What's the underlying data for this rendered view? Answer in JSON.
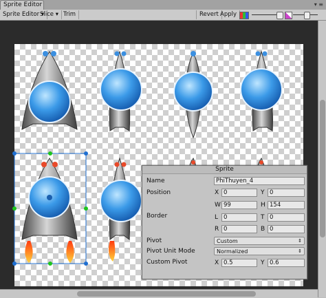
{
  "window": {
    "tab_title": "Sprite Editor",
    "controls": "▾ ≡"
  },
  "toolbar": {
    "sprite_editor_menu": "Sprite Editor ▾",
    "slice_menu": "Slice ▾",
    "trim_label": "Trim",
    "revert_label": "Revert",
    "apply_label": "Apply",
    "zoom_level": 0.55
  },
  "sprite_panel": {
    "title": "Sprite",
    "name_label": "Name",
    "name_value": "PhiThuyen_4",
    "position_label": "Position",
    "x_label": "X",
    "x_value": "0",
    "y_label": "Y",
    "y_value": "0",
    "w_label": "W",
    "w_value": "99",
    "h_label": "H",
    "h_value": "154",
    "border_label": "Border",
    "l_label": "L",
    "l_value": "0",
    "t_label": "T",
    "t_value": "0",
    "r_label": "R",
    "r_value": "0",
    "b_label": "B",
    "b_value": "0",
    "pivot_label": "Pivot",
    "pivot_value": "Custom",
    "pivot_unit_mode_label": "Pivot Unit Mode",
    "pivot_unit_mode_value": "Normalized",
    "custom_pivot_label": "Custom Pivot",
    "custom_pivot_x_label": "X",
    "custom_pivot_x_value": "0.5",
    "custom_pivot_y_label": "Y",
    "custom_pivot_y_value": "0.6"
  },
  "colors": {
    "selection": "#1f6fd1",
    "handle": "#1ec41e",
    "ship_body": "#9c9c9c",
    "dome": "#2a86d8",
    "flame": "#f07a1a"
  }
}
